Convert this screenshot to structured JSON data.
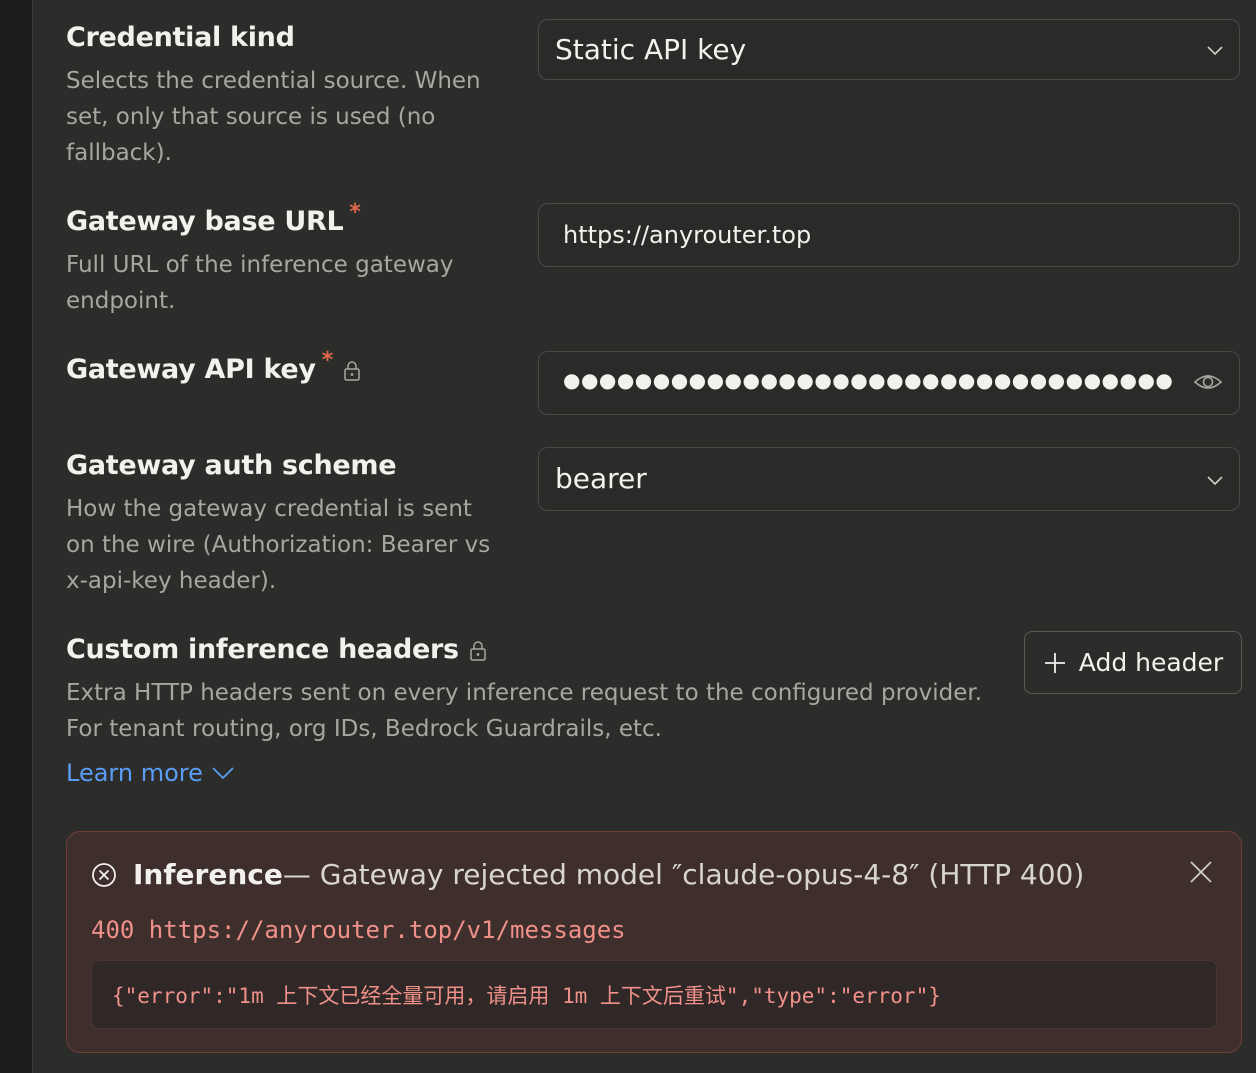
{
  "credential_kind": {
    "title": "Credential kind",
    "description": "Selects the credential source. When set, only that source is used (no fallback).",
    "value": "Static API key"
  },
  "gateway_base_url": {
    "title": "Gateway base URL",
    "required_mark": "*",
    "description": "Full URL of the inference gateway endpoint.",
    "value": "https://anyrouter.top"
  },
  "gateway_api_key": {
    "title": "Gateway API key",
    "required_mark": "*",
    "masked_value": "●●●●●●●●●●●●●●●●●●●●●●●●●●●●●●●●●●●●●●●●●●●●●●●●●●●●●●●●●●●●●●"
  },
  "gateway_auth_scheme": {
    "title": "Gateway auth scheme",
    "description": "How the gateway credential is sent on the wire (Authorization: Bearer vs x-api-key header).",
    "value": "bearer"
  },
  "custom_headers": {
    "title": "Custom inference headers",
    "description_line1": "Extra HTTP headers sent on every inference request to the configured provider.",
    "description_line2": "For tenant routing, org IDs, Bedrock Guardrails, etc.",
    "learn_more": "Learn more",
    "add_button": "Add header"
  },
  "error": {
    "title": "Inference",
    "message": " — Gateway rejected model ″claude-opus-4-8″ (HTTP 400)",
    "request_line": "400 https://anyrouter.top/v1/messages",
    "body": "{\"error\":\"1m 上下文已经全量可用，请启用 1m 上下文后重试\",\"type\":\"error\"}"
  }
}
